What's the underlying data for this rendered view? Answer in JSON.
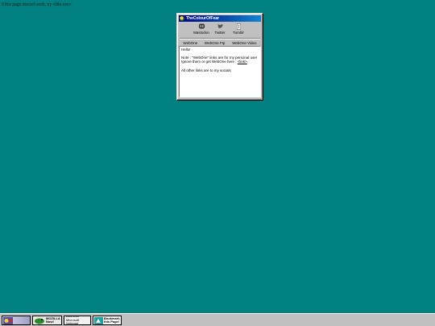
{
  "page_note": "If this page doesn't work, try <title.exe>",
  "window": {
    "title": "TheColourOfFear",
    "socials": [
      {
        "label": "Mastodon",
        "icon": "mastodon-icon"
      },
      {
        "label": "Twitter",
        "icon": "twitter-icon"
      },
      {
        "label": "Tumblr",
        "icon": "tumblr-icon"
      }
    ],
    "links": {
      "webone": "WebOne",
      "webone_ftp": "WebOne Ftp",
      "webone_video": "WebOne Video"
    },
    "content": {
      "greeting": "Hello!",
      "note_line1": "Note : \"WebOne\" links are for my personal use!",
      "note_line2": "Ignore them or get WebOne here : ",
      "link_text": "<link>",
      "note_end": ".",
      "other": "All other links are to my socials"
    }
  },
  "taskbar": {
    "badge1": "",
    "badge2": "MOZILLA Now!",
    "badge3": "Built with Microsoft Notepad",
    "badge4": "Bookmark this Page!"
  },
  "colors": {
    "desktop": "#008080",
    "titlebar": "#000080",
    "face": "#c0c0c0"
  }
}
